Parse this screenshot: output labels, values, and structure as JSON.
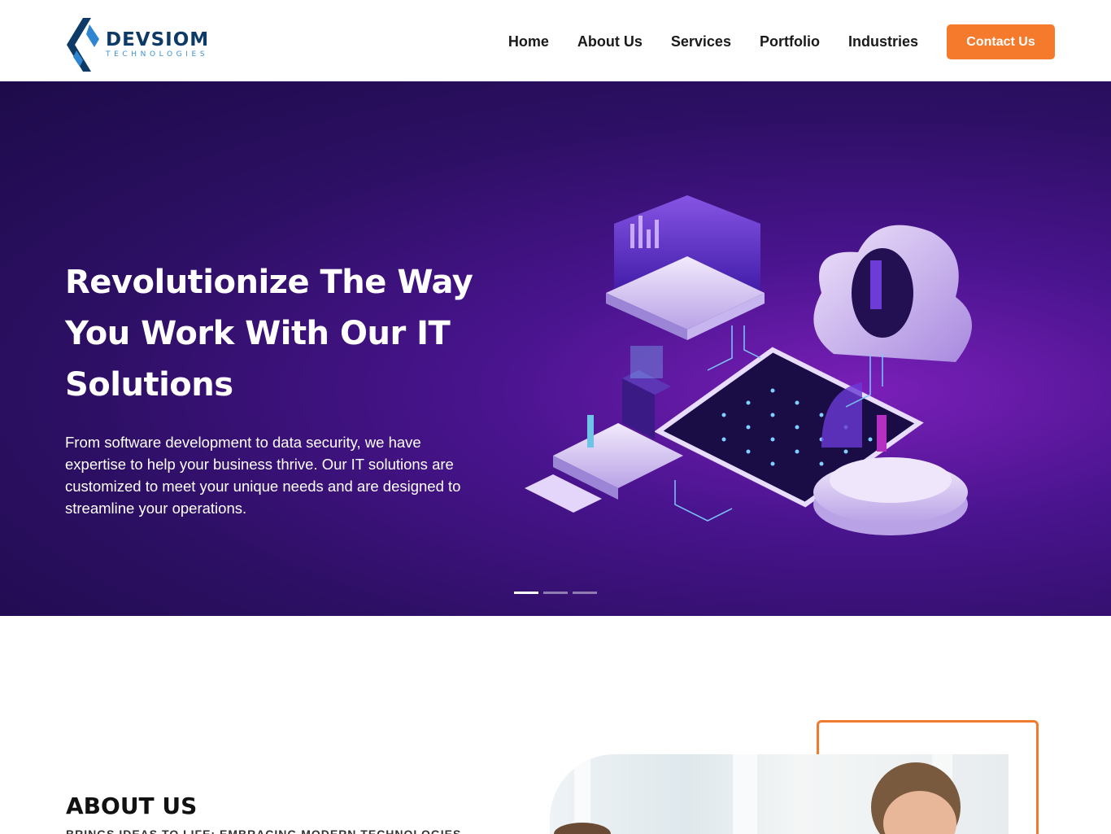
{
  "header": {
    "logo": {
      "name": "DEVSIOM",
      "tagline": "TECHNOLOGIES"
    },
    "nav": [
      {
        "label": "Home"
      },
      {
        "label": "About Us"
      },
      {
        "label": "Services"
      },
      {
        "label": "Portfolio"
      },
      {
        "label": "Industries"
      }
    ],
    "contact_label": "Contact Us"
  },
  "hero": {
    "title": "Revolutionize The Way You Work With Our IT Solutions",
    "text": "From software development to data security, we have expertise to help your business thrive. Our IT solutions are customized to meet your unique needs and are designed to streamline your operations.",
    "slides": {
      "count": 3,
      "active": 1
    }
  },
  "about": {
    "heading": "ABOUT US",
    "subheading": "BRINGS IDEAS TO LIFE: EMBRACING MODERN TECHNOLOGIES"
  },
  "colors": {
    "accent": "#f67a2b",
    "hero_bg": "#2c0f63",
    "logo_navy": "#0d3a66",
    "logo_blue": "#3a8fd3"
  }
}
